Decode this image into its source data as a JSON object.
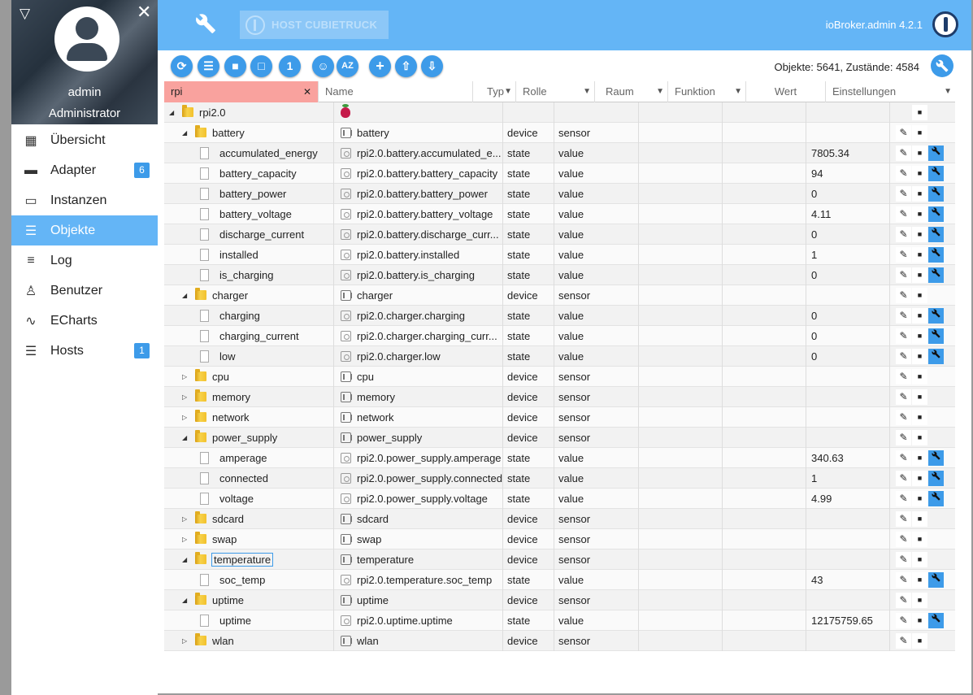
{
  "app": {
    "version": "ioBroker.admin 4.2.1",
    "host_label": "HOST CUBIETRUCK"
  },
  "user": {
    "name": "admin",
    "role": "Administrator"
  },
  "nav": [
    {
      "label": "Übersicht",
      "icon": "grid-icon",
      "badge": ""
    },
    {
      "label": "Adapter",
      "icon": "store-icon",
      "badge": "6"
    },
    {
      "label": "Instanzen",
      "icon": "instances-icon",
      "badge": ""
    },
    {
      "label": "Objekte",
      "icon": "list-icon",
      "badge": "",
      "active": true
    },
    {
      "label": "Log",
      "icon": "log-icon",
      "badge": ""
    },
    {
      "label": "Benutzer",
      "icon": "user-icon",
      "badge": ""
    },
    {
      "label": "ECharts",
      "icon": "chart-icon",
      "badge": ""
    },
    {
      "label": "Hosts",
      "icon": "hosts-icon",
      "badge": "1"
    }
  ],
  "toolbar": {
    "counts": "Objekte: 5641, Zustände: 4584",
    "buttons": [
      "refresh-icon",
      "list-view-icon",
      "folder-icon",
      "folder-open-icon",
      "1",
      "expert-icon",
      "AZ",
      "plus-icon",
      "upload-icon",
      "download-icon"
    ]
  },
  "columns": {
    "filter": "rpi",
    "name": "Name",
    "type": "Typ",
    "role": "Rolle",
    "room": "Raum",
    "function": "Funktion",
    "value": "Wert",
    "settings": "Einstellungen"
  },
  "rows": [
    {
      "level": 0,
      "kind": "folder",
      "exp": "open",
      "id": "rpi2.0",
      "name": "",
      "type": "",
      "role": "",
      "value": "",
      "buttons": [
        "delete"
      ],
      "nameIcon": "raspberry"
    },
    {
      "level": 1,
      "kind": "folder",
      "exp": "open",
      "id": "battery",
      "name": "battery",
      "type": "device",
      "role": "sensor",
      "value": "",
      "buttons": [
        "edit",
        "delete"
      ]
    },
    {
      "level": 2,
      "kind": "state",
      "id": "accumulated_energy",
      "name": "rpi2.0.battery.accumulated_e...",
      "type": "state",
      "role": "value",
      "value": "7805.34",
      "buttons": [
        "edit",
        "delete",
        "wrench"
      ]
    },
    {
      "level": 2,
      "kind": "state",
      "id": "battery_capacity",
      "name": "rpi2.0.battery.battery_capacity",
      "type": "state",
      "role": "value",
      "value": "94",
      "buttons": [
        "edit",
        "delete",
        "wrench"
      ]
    },
    {
      "level": 2,
      "kind": "state",
      "id": "battery_power",
      "name": "rpi2.0.battery.battery_power",
      "type": "state",
      "role": "value",
      "value": "0",
      "buttons": [
        "edit",
        "delete",
        "wrench"
      ]
    },
    {
      "level": 2,
      "kind": "state",
      "id": "battery_voltage",
      "name": "rpi2.0.battery.battery_voltage",
      "type": "state",
      "role": "value",
      "value": "4.11",
      "buttons": [
        "edit",
        "delete",
        "wrench"
      ]
    },
    {
      "level": 2,
      "kind": "state",
      "id": "discharge_current",
      "name": "rpi2.0.battery.discharge_curr...",
      "type": "state",
      "role": "value",
      "value": "0",
      "buttons": [
        "edit",
        "delete",
        "wrench"
      ]
    },
    {
      "level": 2,
      "kind": "state",
      "id": "installed",
      "name": "rpi2.0.battery.installed",
      "type": "state",
      "role": "value",
      "value": "1",
      "buttons": [
        "edit",
        "delete",
        "wrench"
      ]
    },
    {
      "level": 2,
      "kind": "state",
      "id": "is_charging",
      "name": "rpi2.0.battery.is_charging",
      "type": "state",
      "role": "value",
      "value": "0",
      "buttons": [
        "edit",
        "delete",
        "wrench"
      ]
    },
    {
      "level": 1,
      "kind": "folder",
      "exp": "open",
      "id": "charger",
      "name": "charger",
      "type": "device",
      "role": "sensor",
      "value": "",
      "buttons": [
        "edit",
        "delete"
      ]
    },
    {
      "level": 2,
      "kind": "state",
      "id": "charging",
      "name": "rpi2.0.charger.charging",
      "type": "state",
      "role": "value",
      "value": "0",
      "buttons": [
        "edit",
        "delete",
        "wrench"
      ]
    },
    {
      "level": 2,
      "kind": "state",
      "id": "charging_current",
      "name": "rpi2.0.charger.charging_curr...",
      "type": "state",
      "role": "value",
      "value": "0",
      "buttons": [
        "edit",
        "delete",
        "wrench"
      ]
    },
    {
      "level": 2,
      "kind": "state",
      "id": "low",
      "name": "rpi2.0.charger.low",
      "type": "state",
      "role": "value",
      "value": "0",
      "buttons": [
        "edit",
        "delete",
        "wrench"
      ]
    },
    {
      "level": 1,
      "kind": "folder",
      "exp": "closed",
      "id": "cpu",
      "name": "cpu",
      "type": "device",
      "role": "sensor",
      "value": "",
      "buttons": [
        "edit",
        "delete"
      ]
    },
    {
      "level": 1,
      "kind": "folder",
      "exp": "closed",
      "id": "memory",
      "name": "memory",
      "type": "device",
      "role": "sensor",
      "value": "",
      "buttons": [
        "edit",
        "delete"
      ]
    },
    {
      "level": 1,
      "kind": "folder",
      "exp": "closed",
      "id": "network",
      "name": "network",
      "type": "device",
      "role": "sensor",
      "value": "",
      "buttons": [
        "edit",
        "delete"
      ]
    },
    {
      "level": 1,
      "kind": "folder",
      "exp": "open",
      "id": "power_supply",
      "name": "power_supply",
      "type": "device",
      "role": "sensor",
      "value": "",
      "buttons": [
        "edit",
        "delete"
      ]
    },
    {
      "level": 2,
      "kind": "state",
      "id": "amperage",
      "name": "rpi2.0.power_supply.amperage",
      "type": "state",
      "role": "value",
      "value": "340.63",
      "buttons": [
        "edit",
        "delete",
        "wrench"
      ]
    },
    {
      "level": 2,
      "kind": "state",
      "id": "connected",
      "name": "rpi2.0.power_supply.connected",
      "type": "state",
      "role": "value",
      "value": "1",
      "buttons": [
        "edit",
        "delete",
        "wrench"
      ]
    },
    {
      "level": 2,
      "kind": "state",
      "id": "voltage",
      "name": "rpi2.0.power_supply.voltage",
      "type": "state",
      "role": "value",
      "value": "4.99",
      "buttons": [
        "edit",
        "delete",
        "wrench"
      ]
    },
    {
      "level": 1,
      "kind": "folder",
      "exp": "closed",
      "id": "sdcard",
      "name": "sdcard",
      "type": "device",
      "role": "sensor",
      "value": "",
      "buttons": [
        "edit",
        "delete"
      ]
    },
    {
      "level": 1,
      "kind": "folder",
      "exp": "closed",
      "id": "swap",
      "name": "swap",
      "type": "device",
      "role": "sensor",
      "value": "",
      "buttons": [
        "edit",
        "delete"
      ]
    },
    {
      "level": 1,
      "kind": "folder",
      "exp": "open",
      "id": "temperature",
      "name": "temperature",
      "type": "device",
      "role": "sensor",
      "value": "",
      "buttons": [
        "edit",
        "delete"
      ],
      "selected": true
    },
    {
      "level": 2,
      "kind": "state",
      "id": "soc_temp",
      "name": "rpi2.0.temperature.soc_temp",
      "type": "state",
      "role": "value",
      "value": "43",
      "buttons": [
        "edit",
        "delete",
        "wrench"
      ]
    },
    {
      "level": 1,
      "kind": "folder",
      "exp": "open",
      "id": "uptime",
      "name": "uptime",
      "type": "device",
      "role": "sensor",
      "value": "",
      "buttons": [
        "edit",
        "delete"
      ]
    },
    {
      "level": 2,
      "kind": "state",
      "id": "uptime",
      "name": "rpi2.0.uptime.uptime",
      "type": "state",
      "role": "value",
      "value": "12175759.65",
      "buttons": [
        "edit",
        "delete",
        "wrench"
      ]
    },
    {
      "level": 1,
      "kind": "folder",
      "exp": "closed",
      "id": "wlan",
      "name": "wlan",
      "type": "device",
      "role": "sensor",
      "value": "",
      "buttons": [
        "edit",
        "delete"
      ]
    }
  ]
}
